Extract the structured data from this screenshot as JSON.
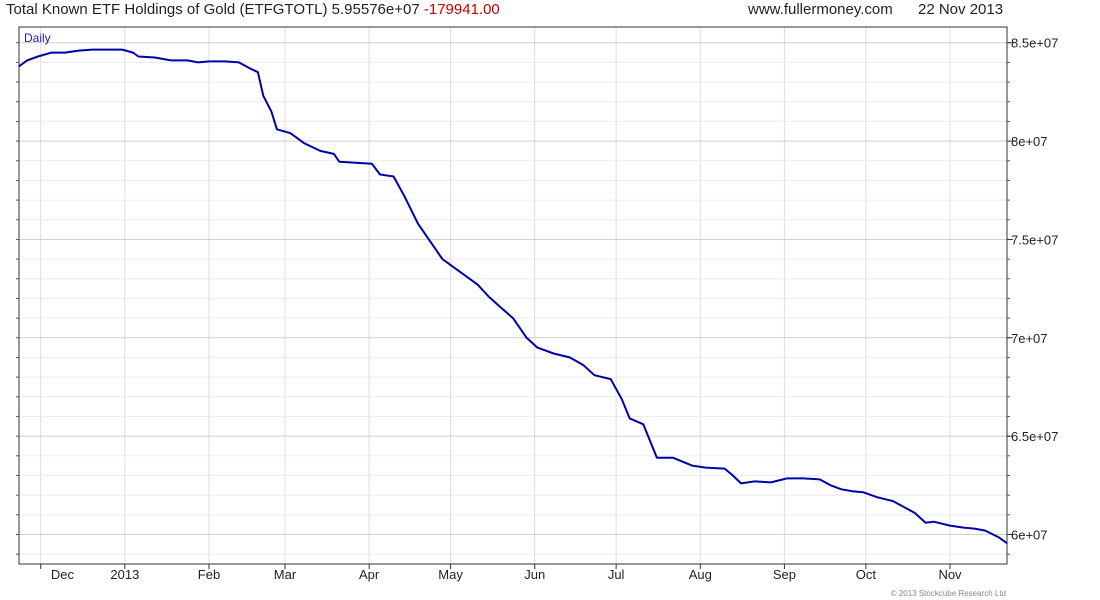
{
  "header": {
    "title": "Total Known ETF Holdings of Gold (ETFGTOTL)",
    "last_value": "5.95576e+07",
    "change": "-179941.00",
    "site": "www.fullermoney.com",
    "date": "22 Nov 2013"
  },
  "copyright": "© 2013 Stockcube Research Ltd",
  "colors": {
    "line": "#0000aa",
    "change": "#c00000",
    "grid": "#dddddd",
    "frame": "#333333"
  },
  "chart_data": {
    "type": "line",
    "title": "Total Known ETF Holdings of Gold (ETFGTOTL)",
    "period_label": "Daily",
    "x_ticks": [
      "Dec",
      "2013",
      "Feb",
      "Mar",
      "Apr",
      "May",
      "Jun",
      "Jul",
      "Aug",
      "Sep",
      "Oct",
      "Nov"
    ],
    "y_ticks": [
      {
        "value": 60000000,
        "label": "6e+07"
      },
      {
        "value": 65000000,
        "label": "6.5e+07"
      },
      {
        "value": 70000000,
        "label": "7e+07"
      },
      {
        "value": 75000000,
        "label": "7.5e+07"
      },
      {
        "value": 80000000,
        "label": "8e+07"
      },
      {
        "value": 85000000,
        "label": "8.5e+07"
      }
    ],
    "ylim": [
      58500000,
      85800000
    ],
    "xlim": [
      "2012-11-23",
      "2013-11-22"
    ],
    "grid": true,
    "series": [
      {
        "name": "",
        "points": [
          [
            "2012-11-23",
            83800000
          ],
          [
            "2012-11-26",
            84100000
          ],
          [
            "2012-11-30",
            84300000
          ],
          [
            "2012-12-05",
            84500000
          ],
          [
            "2012-12-10",
            84500000
          ],
          [
            "2012-12-15",
            84600000
          ],
          [
            "2012-12-20",
            84650000
          ],
          [
            "2012-12-26",
            84650000
          ],
          [
            "2012-12-31",
            84650000
          ],
          [
            "2013-01-04",
            84500000
          ],
          [
            "2013-01-06",
            84300000
          ],
          [
            "2013-01-12",
            84250000
          ],
          [
            "2013-01-18",
            84100000
          ],
          [
            "2013-01-24",
            84100000
          ],
          [
            "2013-01-28",
            84000000
          ],
          [
            "2013-02-01",
            84050000
          ],
          [
            "2013-02-07",
            84050000
          ],
          [
            "2013-02-12",
            84000000
          ],
          [
            "2013-02-16",
            83700000
          ],
          [
            "2013-02-19",
            83500000
          ],
          [
            "2013-02-21",
            82300000
          ],
          [
            "2013-02-24",
            81500000
          ],
          [
            "2013-02-26",
            80600000
          ],
          [
            "2013-03-03",
            80400000
          ],
          [
            "2013-03-08",
            79900000
          ],
          [
            "2013-03-14",
            79500000
          ],
          [
            "2013-03-19",
            79350000
          ],
          [
            "2013-03-21",
            78950000
          ],
          [
            "2013-03-27",
            78900000
          ],
          [
            "2013-04-02",
            78850000
          ],
          [
            "2013-04-05",
            78300000
          ],
          [
            "2013-04-10",
            78200000
          ],
          [
            "2013-04-14",
            77200000
          ],
          [
            "2013-04-19",
            75800000
          ],
          [
            "2013-04-24",
            74800000
          ],
          [
            "2013-04-28",
            74000000
          ],
          [
            "2013-05-03",
            73500000
          ],
          [
            "2013-05-07",
            73100000
          ],
          [
            "2013-05-11",
            72700000
          ],
          [
            "2013-05-15",
            72100000
          ],
          [
            "2013-05-19",
            71600000
          ],
          [
            "2013-05-24",
            71000000
          ],
          [
            "2013-05-29",
            70000000
          ],
          [
            "2013-06-02",
            69500000
          ],
          [
            "2013-06-08",
            69200000
          ],
          [
            "2013-06-14",
            69000000
          ],
          [
            "2013-06-19",
            68600000
          ],
          [
            "2013-06-23",
            68100000
          ],
          [
            "2013-06-29",
            67900000
          ],
          [
            "2013-07-03",
            66900000
          ],
          [
            "2013-07-06",
            65900000
          ],
          [
            "2013-07-11",
            65600000
          ],
          [
            "2013-07-16",
            63900000
          ],
          [
            "2013-07-22",
            63900000
          ],
          [
            "2013-07-29",
            63500000
          ],
          [
            "2013-08-03",
            63400000
          ],
          [
            "2013-08-10",
            63350000
          ],
          [
            "2013-08-13",
            63000000
          ],
          [
            "2013-08-16",
            62600000
          ],
          [
            "2013-08-21",
            62700000
          ],
          [
            "2013-08-27",
            62650000
          ],
          [
            "2013-09-02",
            62850000
          ],
          [
            "2013-09-08",
            62850000
          ],
          [
            "2013-09-14",
            62800000
          ],
          [
            "2013-09-18",
            62500000
          ],
          [
            "2013-09-22",
            62300000
          ],
          [
            "2013-09-26",
            62200000
          ],
          [
            "2013-09-30",
            62150000
          ],
          [
            "2013-10-05",
            61900000
          ],
          [
            "2013-10-11",
            61700000
          ],
          [
            "2013-10-15",
            61400000
          ],
          [
            "2013-10-19",
            61100000
          ],
          [
            "2013-10-23",
            60600000
          ],
          [
            "2013-10-26",
            60650000
          ],
          [
            "2013-11-01",
            60450000
          ],
          [
            "2013-11-06",
            60350000
          ],
          [
            "2013-11-10",
            60300000
          ],
          [
            "2013-11-14",
            60200000
          ],
          [
            "2013-11-19",
            59850000
          ],
          [
            "2013-11-22",
            59557600
          ]
        ]
      }
    ]
  }
}
